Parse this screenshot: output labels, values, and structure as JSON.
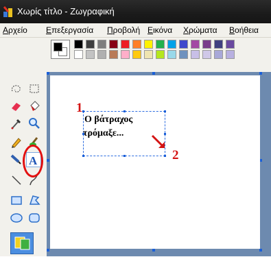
{
  "window": {
    "title": "Χωρίς τίτλο - Ζωγραφική",
    "app_icon": "paint-app-icon"
  },
  "menubar": {
    "items": [
      {
        "label": "Αρχείο"
      },
      {
        "label": "Επεξεργασία"
      },
      {
        "label": "Προβολή"
      },
      {
        "label": "Εικόνα"
      },
      {
        "label": "Χρώματα"
      },
      {
        "label": "Βοήθεια"
      }
    ]
  },
  "palette": {
    "foreground": "#000000",
    "background": "#ffffff",
    "row1": [
      "#000000",
      "#3f3f3f",
      "#7f7f7f",
      "#880015",
      "#ed1c24",
      "#ff7f27",
      "#fff200",
      "#22b14c",
      "#00a2e8",
      "#3f48cc",
      "#a349a4",
      "#7a3c8c",
      "#404080",
      "#6a4aa0"
    ],
    "row2": [
      "#ffffff",
      "#c3c3c3",
      "#b0b0b0",
      "#b97a57",
      "#ffaec9",
      "#ffc90e",
      "#efe4b0",
      "#b5e61d",
      "#99d9ea",
      "#7092be",
      "#c8bfe7",
      "#d0c8e8",
      "#a8a8d8",
      "#b8b0e0"
    ]
  },
  "toolbox": {
    "tools": [
      "free-select-icon",
      "rect-select-icon",
      "eraser-icon",
      "fill-bucket-icon",
      "color-picker-icon",
      "magnifier-icon",
      "pencil-icon",
      "brush-icon",
      "airbrush-icon",
      "text-icon",
      "line-icon",
      "curve-icon",
      "rectangle-icon",
      "polygon-icon",
      "ellipse-icon",
      "rounded-rect-icon"
    ],
    "selected": "text-icon"
  },
  "canvas": {
    "text_lines": [
      "Ο βάτραχος",
      "τρόμαξε..."
    ],
    "annotations": {
      "marker1": "1",
      "marker2": "2"
    }
  }
}
